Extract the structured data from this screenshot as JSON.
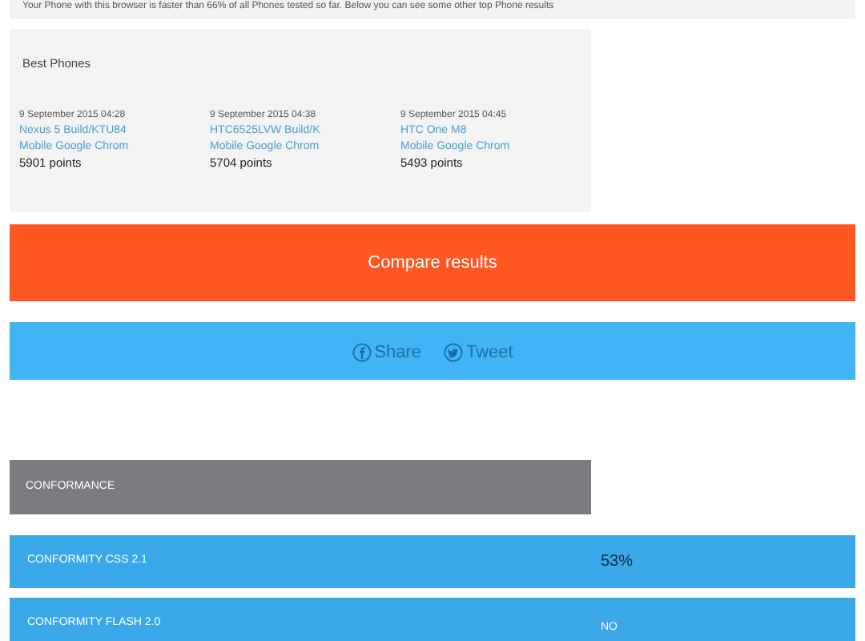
{
  "summary": "Your Phone with this browser is faster than 66% of all Phones tested so far. Below you can see some other top Phone results",
  "best_phones": {
    "title": "Best Phones",
    "items": [
      {
        "date": "9 September 2015 04:28",
        "device": "Nexus 5 Build/KTU84",
        "browser": "Mobile Google Chrom",
        "points": "5901 points"
      },
      {
        "date": "9 September 2015 04:38",
        "device": "HTC6525LVW Build/K",
        "browser": "Mobile Google Chrom",
        "points": "5704 points"
      },
      {
        "date": "9 September 2015 04:45",
        "device": "HTC One M8",
        "browser": "Mobile Google Chrom",
        "points": "5493 points"
      }
    ]
  },
  "compare_button": "Compare results",
  "share": [
    {
      "kind": "facebook",
      "label": "Share"
    },
    {
      "kind": "twitter",
      "label": "Tweet"
    }
  ],
  "conformance": {
    "title": "CONFORMANCE",
    "rows": [
      {
        "label": "CONFORMITY CSS 2.1",
        "value": "53%",
        "kind": "percent"
      },
      {
        "label": "CONFORMITY FLASH 2.0",
        "value": "NO",
        "kind": "flag"
      }
    ]
  }
}
